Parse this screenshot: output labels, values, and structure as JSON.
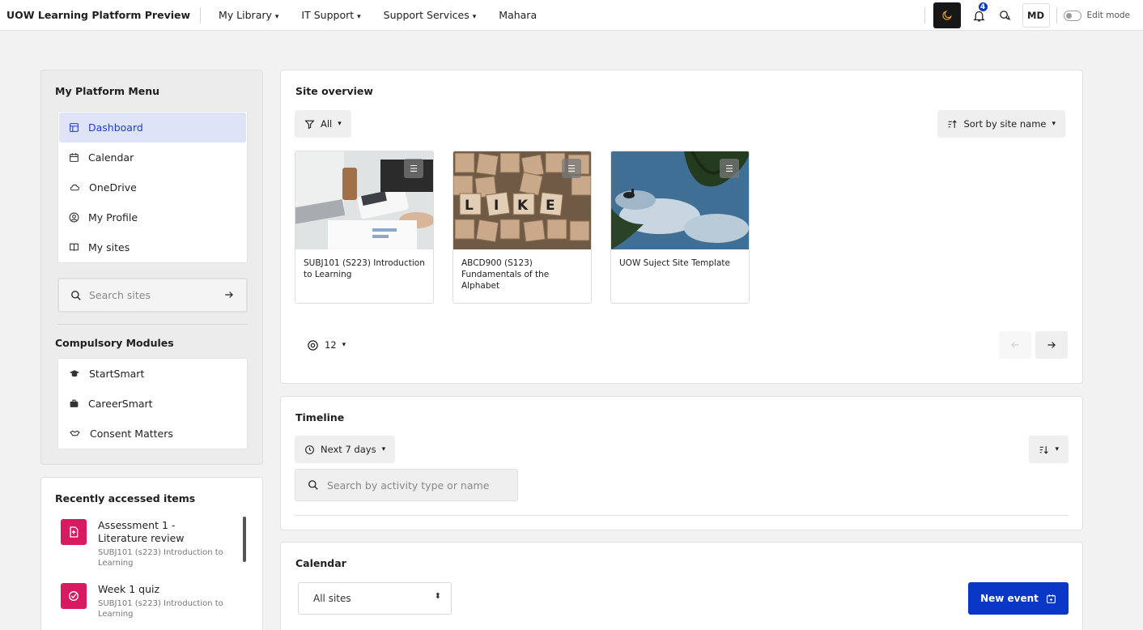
{
  "topbar": {
    "brand": "UOW Learning Platform Preview",
    "nav": [
      {
        "label": "My Library",
        "caret": "▾"
      },
      {
        "label": "IT Support",
        "caret": "▾"
      },
      {
        "label": "Support Services",
        "caret": "▾"
      },
      {
        "label": "Mahara",
        "caret": ""
      }
    ],
    "notification_count": "4",
    "avatar_initials": "MD",
    "edit_mode_label": "Edit mode"
  },
  "sidebar": {
    "menu_title": "My Platform Menu",
    "items": [
      {
        "label": "Dashboard",
        "icon": "dashboard-icon",
        "active": true
      },
      {
        "label": "Calendar",
        "icon": "calendar-icon"
      },
      {
        "label": "OneDrive",
        "icon": "cloud-icon"
      },
      {
        "label": "My Profile",
        "icon": "profile-icon"
      },
      {
        "label": "My sites",
        "icon": "book-icon"
      }
    ],
    "search_placeholder": "Search sites",
    "modules_title": "Compulsory Modules",
    "modules": [
      {
        "label": "StartSmart",
        "icon": "graduation-cap-icon"
      },
      {
        "label": "CareerSmart",
        "icon": "briefcase-icon"
      },
      {
        "label": "Consent Matters",
        "icon": "handshake-icon"
      }
    ]
  },
  "recent": {
    "title": "Recently accessed items",
    "items": [
      {
        "title": "Assessment 1 - Literature review",
        "subtitle": "SUBJ101 (s223) Introduction to Learning",
        "icon": "assignment-icon"
      },
      {
        "title": "Week 1 quiz",
        "subtitle": "SUBJ101 (s223) Introduction to Learning",
        "icon": "quiz-icon"
      }
    ]
  },
  "site_overview": {
    "title": "Site overview",
    "filter_label": "All",
    "sort_label": "Sort by site name",
    "sites": [
      {
        "name": "SUBJ101 (S223) Introduction to Learning",
        "image": "calculator-desk-photo"
      },
      {
        "name": "ABCD900 (S123) Fundamentals of the Alphabet",
        "image": "scrabble-tiles-photo"
      },
      {
        "name": "UOW Suject Site Template",
        "image": "lake-reflection-photo"
      }
    ],
    "per_page": "12"
  },
  "timeline": {
    "title": "Timeline",
    "range_label": "Next 7 days",
    "search_placeholder": "Search by activity type or name"
  },
  "calendar": {
    "title": "Calendar",
    "site_select": "All sites",
    "new_event_label": "New event"
  },
  "colors": {
    "accent": "#0b37c6",
    "active_bg": "#dfe3f7",
    "recent_icon": "#d81b60"
  }
}
